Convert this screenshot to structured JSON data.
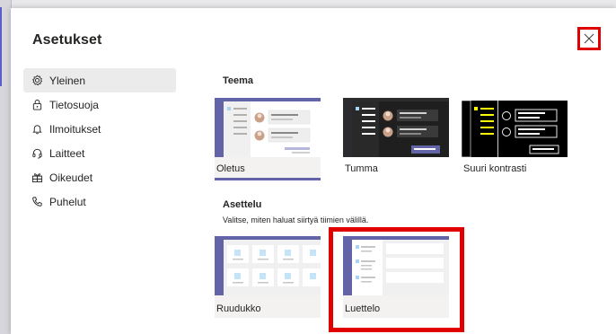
{
  "dialog": {
    "title": "Asetukset",
    "close_glyph": "×"
  },
  "nav": {
    "items": [
      {
        "label": "Yleinen",
        "icon": "gear-icon",
        "active": true
      },
      {
        "label": "Tietosuoja",
        "icon": "lock-icon"
      },
      {
        "label": "Ilmoitukset",
        "icon": "bell-icon"
      },
      {
        "label": "Laitteet",
        "icon": "headset-icon"
      },
      {
        "label": "Oikeudet",
        "icon": "permissions-icon"
      },
      {
        "label": "Puhelut",
        "icon": "phone-icon"
      }
    ]
  },
  "theme": {
    "heading": "Teema",
    "options": [
      {
        "label": "Oletus",
        "selected": true
      },
      {
        "label": "Tumma"
      },
      {
        "label": "Suuri kontrasti"
      }
    ]
  },
  "layout": {
    "heading": "Asettelu",
    "description": "Valitse, miten haluat siirtyä tiimien välillä.",
    "options": [
      {
        "label": "Ruudukko"
      },
      {
        "label": "Luettelo",
        "selected": true
      }
    ]
  },
  "colors": {
    "accent": "#6264a7",
    "highlight": "#e00000",
    "hc_yellow": "#ffff01"
  }
}
